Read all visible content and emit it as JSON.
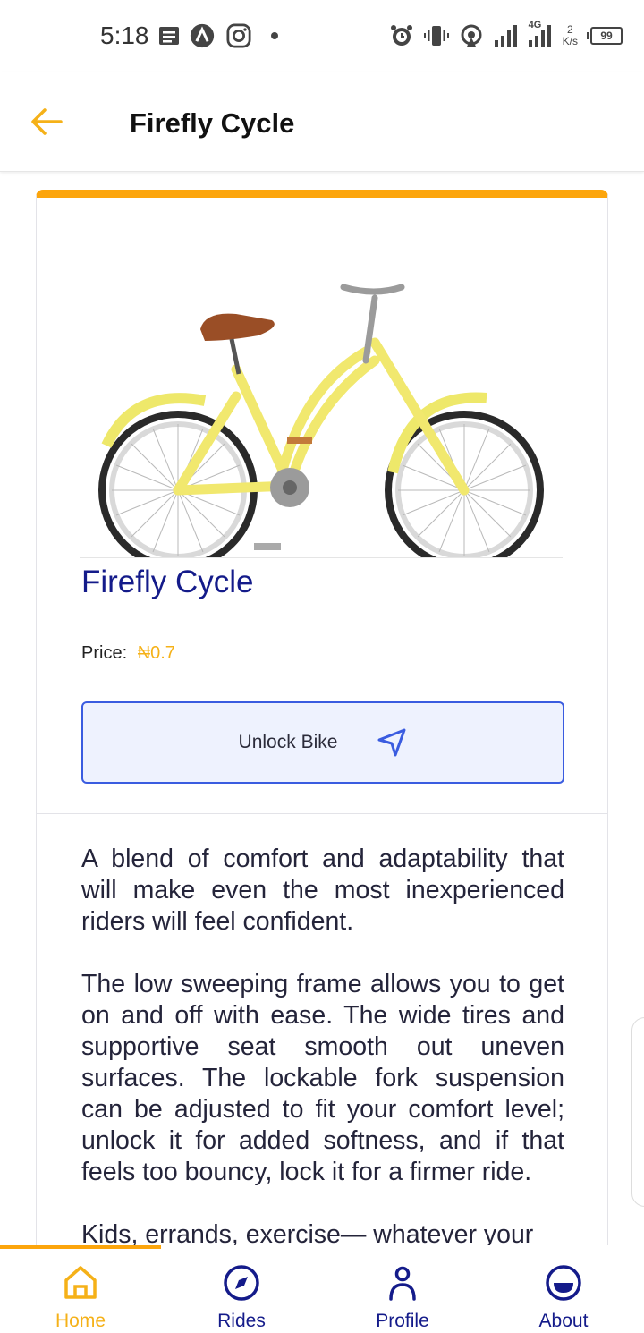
{
  "status_bar": {
    "time": "5:18",
    "network": "4G",
    "speed_value": "2",
    "speed_unit": "K/s",
    "battery": "99"
  },
  "header": {
    "title": "Firefly Cycle"
  },
  "product": {
    "name": "Firefly Cycle",
    "price_label": "Price:",
    "price_value": "₦0.7",
    "unlock_label": "Unlock Bike",
    "description": [
      "A blend of comfort and adaptability that will make even the most inexperienced riders will feel confident.",
      "The low sweeping frame allows you to get on and off with ease. The wide tires and supportive seat smooth out uneven surfaces. The lockable fork suspension can be adjusted to fit your comfort level; unlock it for added softness, and if that feels too bouncy, lock it for a firmer ride.",
      "Kids, errands, exercise— whatever your"
    ]
  },
  "bottom_nav": {
    "items": [
      {
        "label": "Home",
        "icon": "home-icon",
        "active": true
      },
      {
        "label": "Rides",
        "icon": "compass-icon",
        "active": false
      },
      {
        "label": "Profile",
        "icon": "person-icon",
        "active": false
      },
      {
        "label": "About",
        "icon": "about-icon",
        "active": false
      }
    ]
  },
  "colors": {
    "accent": "#fca50c",
    "primary": "#141b8a",
    "button_border": "#3a5ce0",
    "button_bg": "#eef2fe"
  }
}
